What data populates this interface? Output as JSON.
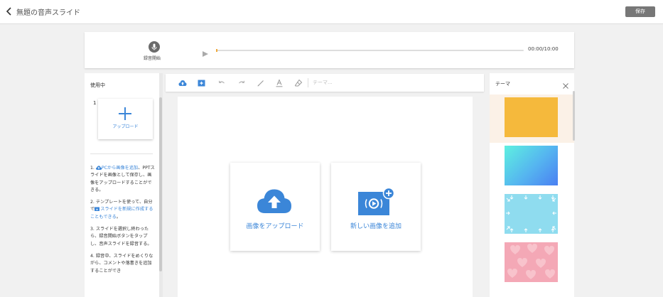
{
  "header": {
    "title": "無題の音声スライド",
    "save_label": "保存"
  },
  "recorder": {
    "record_label": "録音開始",
    "time": "00:00/10:00",
    "progress": 0
  },
  "slides_panel": {
    "title": "使用中",
    "slides": [
      {
        "number": "1",
        "upload_label": "アップロード"
      }
    ],
    "instructions": {
      "step1_prefix": "1. ",
      "step1_link": "PCから画像を追加",
      "step1_text": "、PPTスライドを画像として保存し、画像をアップロードすることができる。",
      "step2_prefix": "2. テンプレートを使って、自分で",
      "step2_link": "スライドを新規に作成することもできる",
      "step2_suffix": "。",
      "step3": "3. スライドを選択し終わったら、録音開始ボタンをタップし、音声スライドを録音する。",
      "step4": "4. 録音中、スライドをめくりながら、コメントや落書きを追加することができ"
    }
  },
  "toolbar": {
    "tools": [
      "cloud-upload-icon",
      "add-image-icon",
      "undo-icon",
      "redo-icon",
      "pen-icon",
      "text-color-icon",
      "eraser-icon"
    ],
    "theme_placeholder": "テーマ..."
  },
  "canvas": {
    "upload_card_label": "画像をアップロード",
    "new_image_card_label": "新しい画像を追加"
  },
  "theme_panel": {
    "title": "テーマ",
    "themes": [
      {
        "name": "orange",
        "selected": true
      },
      {
        "name": "cyan-blue-gradient",
        "selected": false
      },
      {
        "name": "light-blue-arrows",
        "selected": false
      },
      {
        "name": "pink-hearts",
        "selected": false
      }
    ]
  },
  "colors": {
    "accent": "#3b86d8",
    "progress": "#f0a93b",
    "save_button": "#777777",
    "theme_orange": "#f5b93c",
    "theme_selected_bg": "#fbf1e7"
  }
}
